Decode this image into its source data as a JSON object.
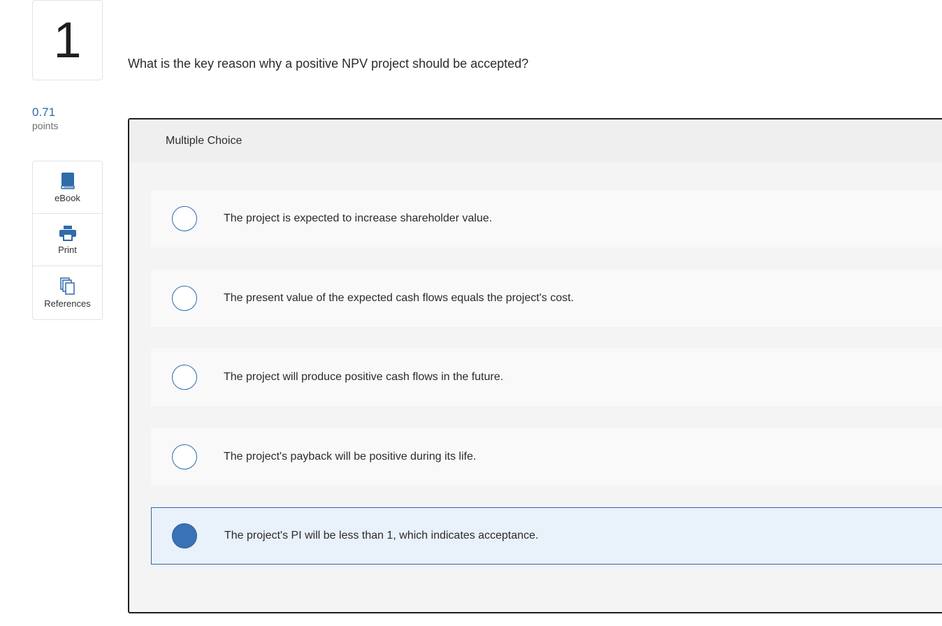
{
  "question_number": "1",
  "points": {
    "value": "0.71",
    "label": "points"
  },
  "tools": [
    {
      "label": "eBook",
      "icon": "book-icon"
    },
    {
      "label": "Print",
      "icon": "printer-icon"
    },
    {
      "label": "References",
      "icon": "documents-icon"
    }
  ],
  "question_text": "What is the key reason why a positive NPV project should be accepted?",
  "multiple_choice": {
    "header": "Multiple Choice",
    "accent_color": "#2f6bab",
    "selected_index": 4,
    "choices": [
      "The project is expected to increase shareholder value.",
      "The present value of the expected cash flows equals the project's cost.",
      "The project will produce positive cash flows in the future.",
      "The project's payback will be positive during its life.",
      "The project's PI will be less than 1, which indicates acceptance."
    ]
  }
}
